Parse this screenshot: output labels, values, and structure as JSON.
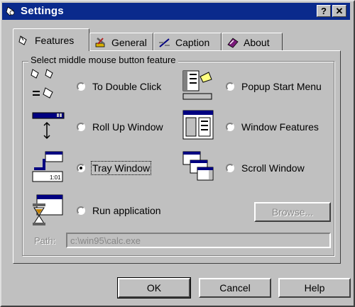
{
  "window": {
    "title": "Settings",
    "help_button": "?",
    "close_button": "✕"
  },
  "tabs": [
    {
      "label": "Features",
      "icon": "mouse-icon",
      "active": true
    },
    {
      "label": "General",
      "icon": "tools-icon",
      "active": false
    },
    {
      "label": "Caption",
      "icon": "caption-icon",
      "active": false
    },
    {
      "label": "About",
      "icon": "about-icon",
      "active": false
    }
  ],
  "group": {
    "label": "Select middle mouse button feature"
  },
  "options": {
    "double_click": {
      "label": "To Double Click",
      "checked": false,
      "icon": "double-click-icon"
    },
    "roll_up": {
      "label": "Roll Up Window",
      "checked": false,
      "icon": "roll-up-icon"
    },
    "tray_window": {
      "label": "Tray Window",
      "checked": true,
      "icon": "tray-window-icon"
    },
    "run_application": {
      "label": "Run application",
      "checked": false,
      "icon": "hourglass-icon"
    },
    "popup_start": {
      "label": "Popup Start Menu",
      "checked": false,
      "icon": "start-menu-icon"
    },
    "window_features": {
      "label": "Window Features",
      "checked": false,
      "icon": "window-features-icon"
    },
    "scroll_window": {
      "label": "Scroll Window",
      "checked": false,
      "icon": "scroll-window-icon"
    }
  },
  "browse_button": "Browse...",
  "path": {
    "label": "Path:",
    "value": "c:\\win95\\calc.exe"
  },
  "buttons": {
    "ok": "OK",
    "cancel": "Cancel",
    "help": "Help"
  },
  "colors": {
    "titlebar": "#0a2a8c",
    "face": "#c0c0c0"
  }
}
